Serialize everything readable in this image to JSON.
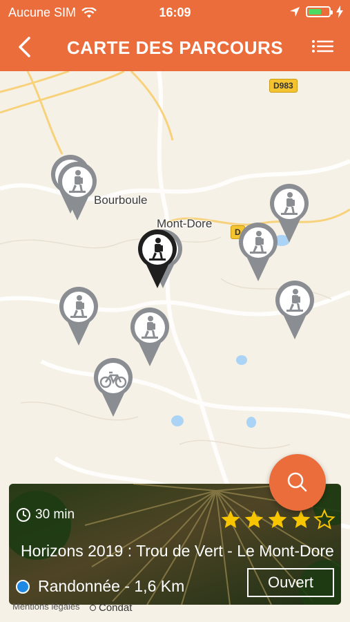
{
  "status_bar": {
    "carrier": "Aucune SIM",
    "time": "16:09"
  },
  "header": {
    "title": "CARTE DES PARCOURS"
  },
  "map": {
    "road_label": "D983",
    "road_label_partial": "D",
    "places": {
      "bourboule": "Bourboule",
      "mont_dore": "Mont-Dore",
      "condat": "Condat"
    },
    "legal": "Mentions légales"
  },
  "colors": {
    "accent": "#ec6d3c",
    "pin_gray": "#8a8d91",
    "pin_selected": "#1f1f1f",
    "star": "#f7c600",
    "category_dot": "#1e88e5"
  },
  "card": {
    "duration": "30 min",
    "rating": 4,
    "rating_max": 5,
    "title": "Horizons 2019 : Trou de Vert - Le Mont-Dore",
    "category": "Randonnée - 1,6 Km",
    "status": "Ouvert"
  },
  "icons": {
    "back": "chevron-left-icon",
    "menu": "list-icon",
    "search": "search-icon",
    "hiker": "hiker-icon",
    "bike": "bike-icon",
    "clock": "clock-icon"
  }
}
